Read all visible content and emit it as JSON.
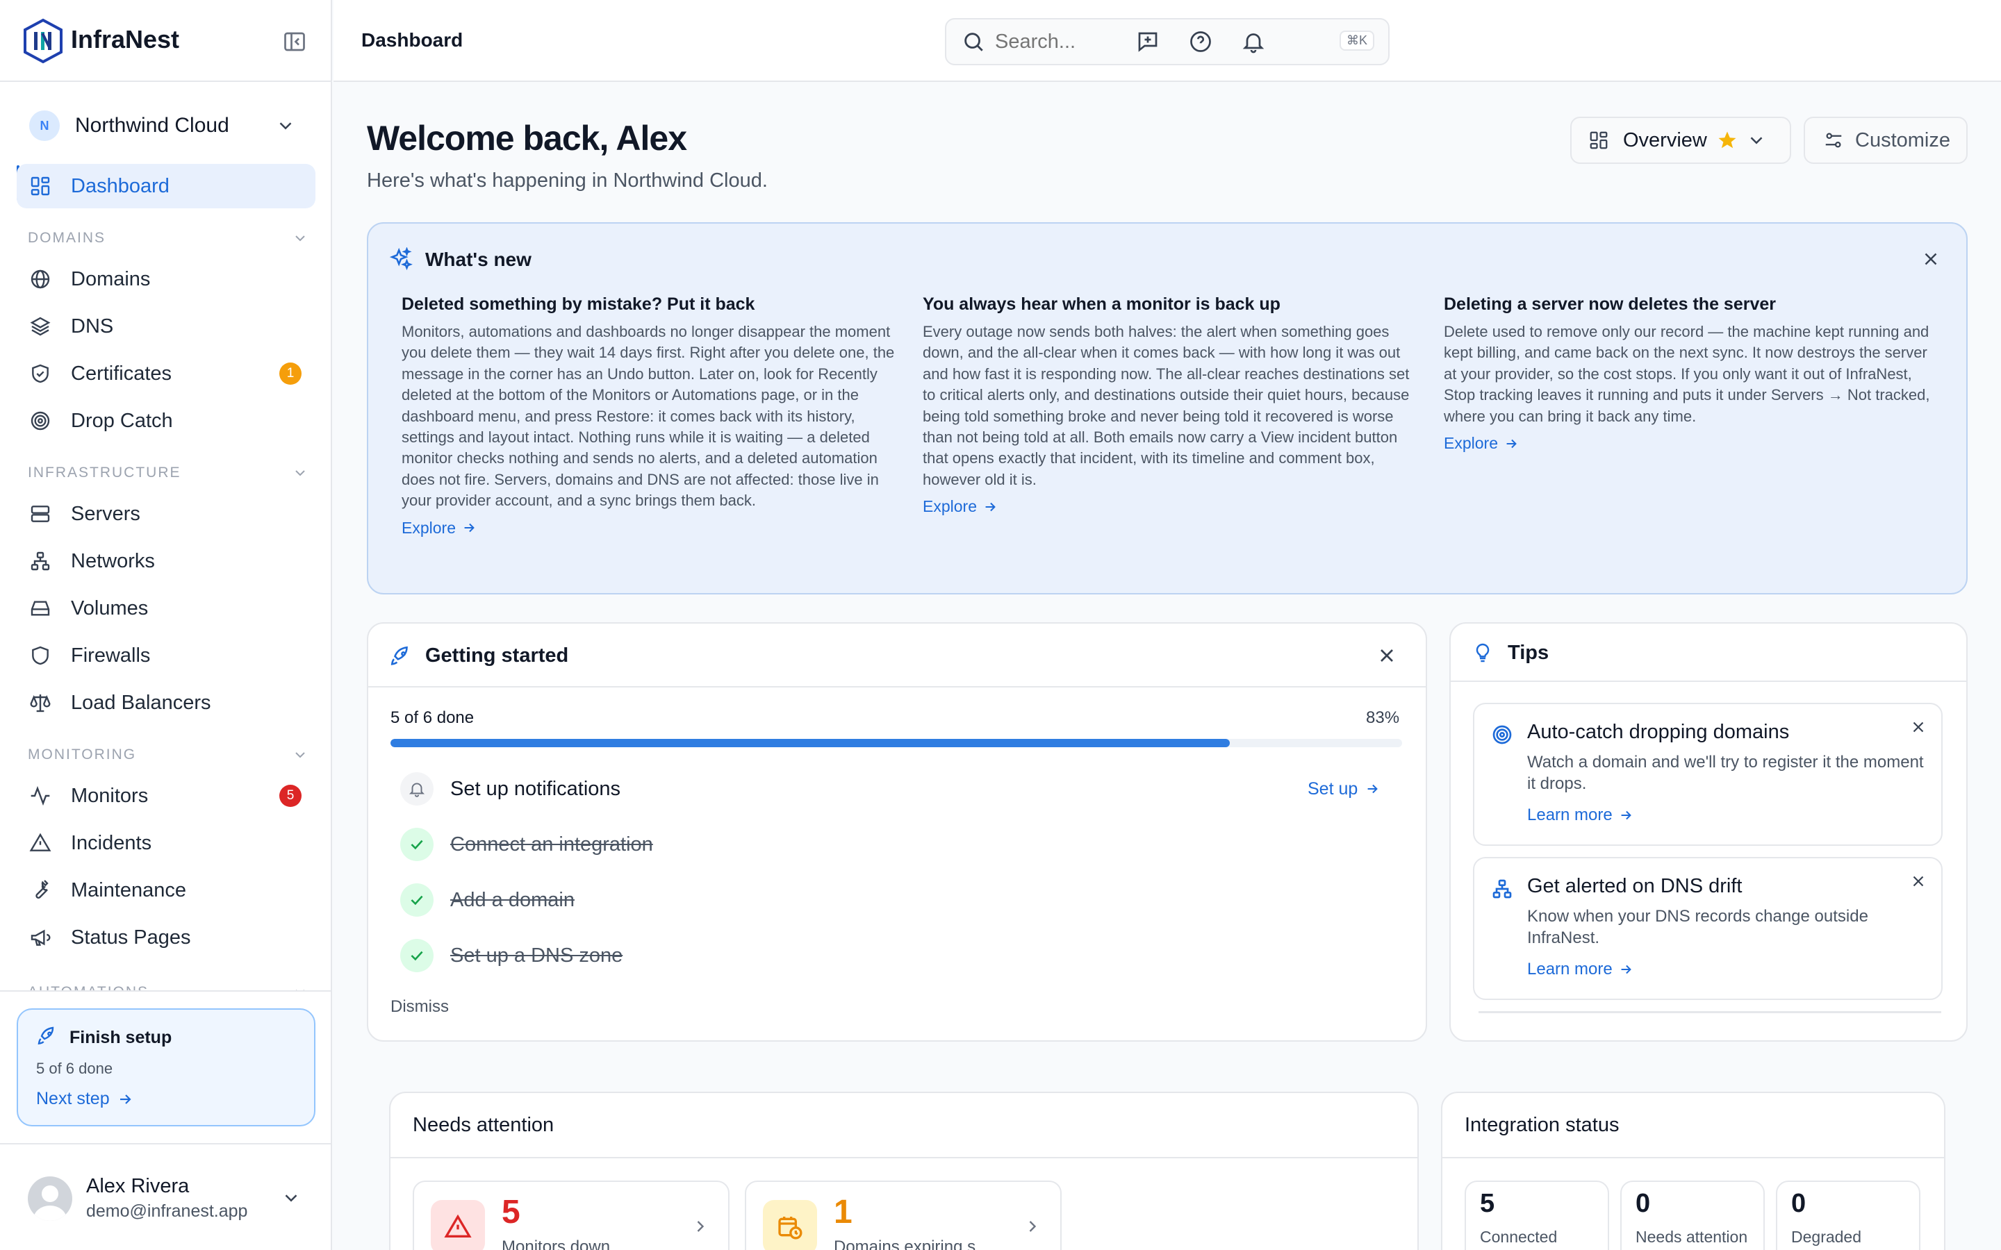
{
  "app": {
    "name": "InfraNest"
  },
  "workspace": {
    "name": "Northwind Cloud",
    "initial": "N"
  },
  "nav": {
    "dashboard": "Dashboard",
    "sections": {
      "domains": "DOMAINS",
      "infrastructure": "INFRASTRUCTURE",
      "monitoring": "MONITORING",
      "automations": "AUTOMATIONS"
    },
    "domains": "Domains",
    "dns": "DNS",
    "certificates": "Certificates",
    "certificates_badge": "1",
    "drop_catch": "Drop Catch",
    "servers": "Servers",
    "networks": "Networks",
    "volumes": "Volumes",
    "firewalls": "Firewalls",
    "load_balancers": "Load Balancers",
    "monitors": "Monitors",
    "monitors_badge": "5",
    "incidents": "Incidents",
    "maintenance": "Maintenance",
    "status_pages": "Status Pages"
  },
  "finish_setup": {
    "title": "Finish setup",
    "progress": "5 of 6 done",
    "link": "Next step"
  },
  "user": {
    "name": "Alex Rivera",
    "email": "demo@infranest.app"
  },
  "header": {
    "title": "Dashboard",
    "search_placeholder": "Search...",
    "search_shortcut": "⌘K"
  },
  "welcome": {
    "title": "Welcome back, Alex",
    "subtitle": "Here's what's happening in Northwind Cloud."
  },
  "view": {
    "label": "Overview",
    "customize": "Customize"
  },
  "whats_new": {
    "title": "What's new",
    "items": [
      {
        "title": "Deleted something by mistake? Put it back",
        "body": "Monitors, automations and dashboards no longer disappear the moment you delete them — they wait 14 days first. Right after you delete one, the message in the corner has an Undo button. Later on, look for Recently deleted at the bottom of the Monitors or Automations page, or in the dashboard menu, and press Restore: it comes back with its history, settings and layout intact. Nothing runs while it is waiting — a deleted monitor checks nothing and sends no alerts, and a deleted automation does not fire. Servers, domains and DNS are not affected: those live in your provider account, and a sync brings them back.",
        "link": "Explore"
      },
      {
        "title": "You always hear when a monitor is back up",
        "body": "Every outage now sends both halves: the alert when something goes down, and the all-clear when it comes back — with how long it was out and how fast it is responding now. The all-clear reaches destinations set to critical alerts only, and destinations outside their quiet hours, because being told something broke and never being told it recovered is worse than not being told at all. Both emails now carry a View incident button that opens exactly that incident, with its timeline and comment box, however old it is.",
        "link": "Explore"
      },
      {
        "title": "Deleting a server now deletes the server",
        "body": "Delete used to remove only our record — the machine kept running and kept billing, and came back on the next sync. It now destroys the server at your provider, so the cost stops. If you only want it out of InfraNest, Stop tracking leaves it running and puts it under Servers → Not tracked, where you can bring it back any time.",
        "link": "Explore"
      }
    ]
  },
  "getting_started": {
    "title": "Getting started",
    "progress_text": "5 of 6 done",
    "percent": "83%",
    "progress_value": 83,
    "steps": [
      {
        "label": "Set up notifications",
        "action": "Set up"
      },
      {
        "label": "Connect an integration"
      },
      {
        "label": "Add a domain"
      },
      {
        "label": "Set up a DNS zone"
      }
    ],
    "dismiss": "Dismiss"
  },
  "tips": {
    "title": "Tips",
    "items": [
      {
        "title": "Auto-catch dropping domains",
        "body": "Watch a domain and we'll try to register it the moment it drops.",
        "link": "Learn more"
      },
      {
        "title": "Get alerted on DNS drift",
        "body": "Know when your DNS records change outside InfraNest.",
        "link": "Learn more"
      }
    ]
  },
  "needs_attention": {
    "title": "Needs attention",
    "items": [
      {
        "value": "5",
        "label": "Monitors down",
        "color": "#dc2626"
      },
      {
        "value": "1",
        "label": "Domains expiring s",
        "color": "#ea8a06"
      }
    ]
  },
  "integration_status": {
    "title": "Integration status",
    "items": [
      {
        "value": "5",
        "label": "Connected"
      },
      {
        "value": "0",
        "label": "Needs attention"
      },
      {
        "value": "0",
        "label": "Degraded"
      }
    ]
  },
  "colors": {
    "accent": "#1d6ad8",
    "progress": "#2f7de1",
    "danger": "#dc2626",
    "warning": "#f59e0b",
    "success": "#16a34a"
  }
}
